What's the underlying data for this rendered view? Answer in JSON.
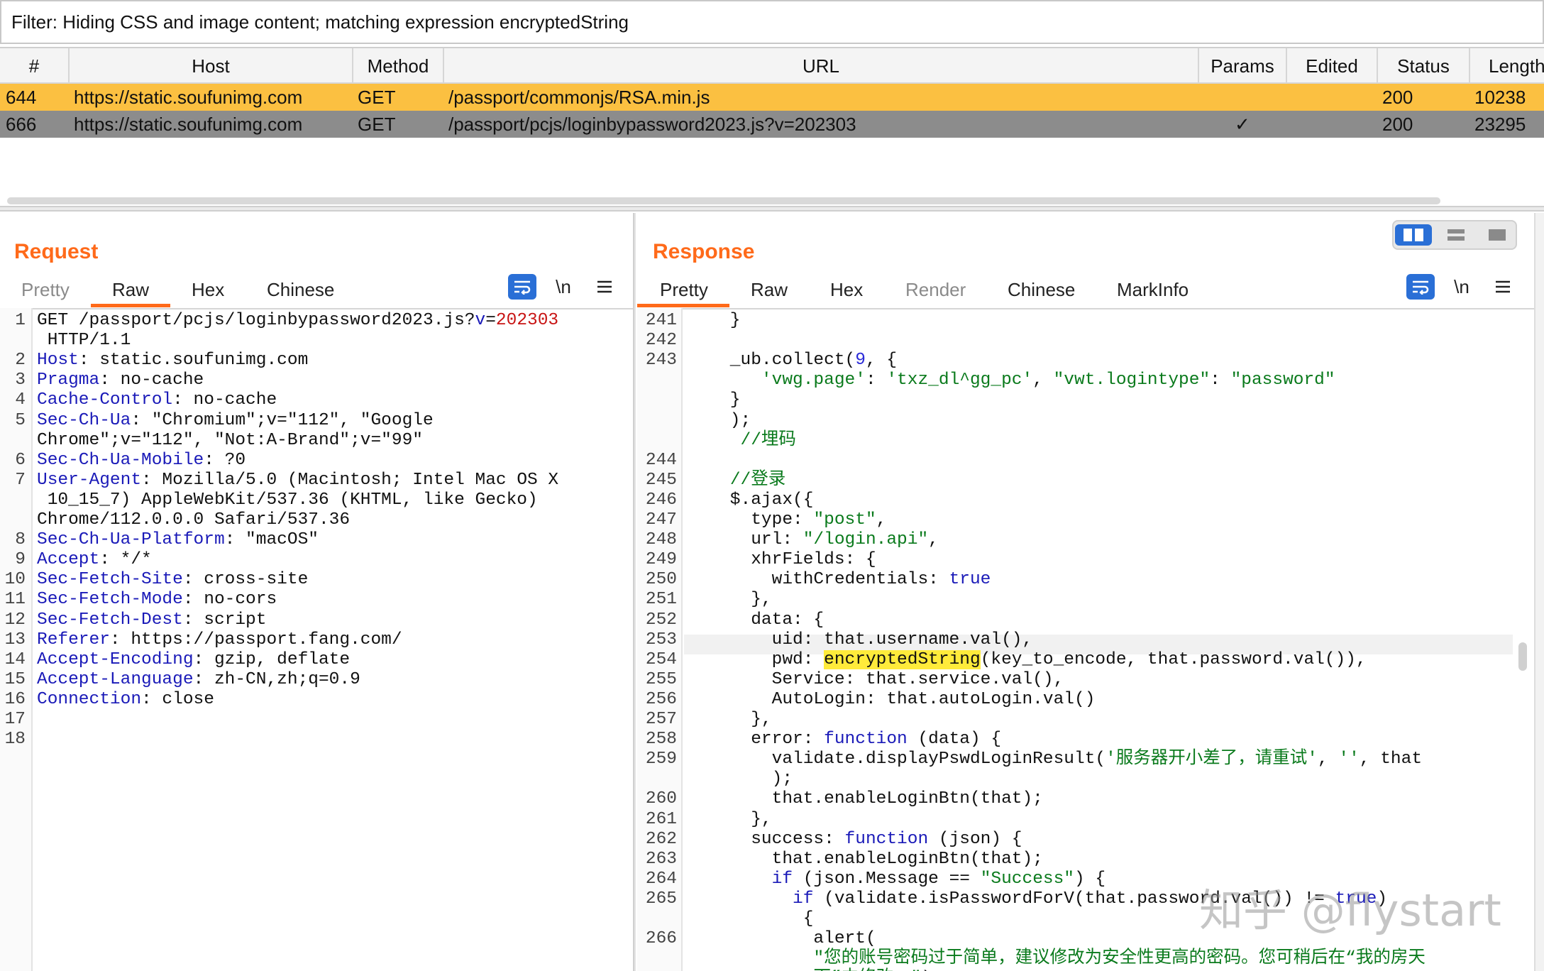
{
  "filter": {
    "text": "Filter: Hiding CSS and image content;  matching expression encryptedString"
  },
  "history": {
    "columns": [
      "#",
      "Host",
      "Method",
      "URL",
      "Params",
      "Edited",
      "Status",
      "Length"
    ],
    "rows": [
      {
        "num": "644",
        "host": "https://static.soufunimg.com",
        "method": "GET",
        "url": "/passport/commonjs/RSA.min.js",
        "params": "",
        "edited": "",
        "status": "200",
        "length": "10238"
      },
      {
        "num": "666",
        "host": "https://static.soufunimg.com",
        "method": "GET",
        "url": "/passport/pcjs/loginbypassword2023.js?v=202303",
        "params": "✓",
        "edited": "",
        "status": "200",
        "length": "23295"
      }
    ]
  },
  "request": {
    "title": "Request",
    "tabs": [
      "Pretty",
      "Raw",
      "Hex",
      "Chinese"
    ],
    "active_tab": "Raw",
    "newline_label": "\\n",
    "lines": [
      {
        "num": "1",
        "parts": [
          [
            "",
            "GET /passport/pcjs/loginbypassword2023.js?"
          ],
          [
            "k",
            "v"
          ],
          [
            "",
            "="
          ],
          [
            "v",
            "202303"
          ]
        ]
      },
      {
        "num": "",
        "parts": [
          [
            "",
            " HTTP/1.1"
          ]
        ]
      },
      {
        "num": "2",
        "parts": [
          [
            "k",
            "Host"
          ],
          [
            "",
            ": static.soufunimg.com"
          ]
        ]
      },
      {
        "num": "3",
        "parts": [
          [
            "k",
            "Pragma"
          ],
          [
            "",
            ": no-cache"
          ]
        ]
      },
      {
        "num": "4",
        "parts": [
          [
            "k",
            "Cache-Control"
          ],
          [
            "",
            ": no-cache"
          ]
        ]
      },
      {
        "num": "5",
        "parts": [
          [
            "k",
            "Sec-Ch-Ua"
          ],
          [
            "",
            ": \"Chromium\";v=\"112\", \"Google"
          ]
        ]
      },
      {
        "num": "",
        "parts": [
          [
            "",
            "Chrome\";v=\"112\", \"Not:A-Brand\";v=\"99\""
          ]
        ]
      },
      {
        "num": "6",
        "parts": [
          [
            "k",
            "Sec-Ch-Ua-Mobile"
          ],
          [
            "",
            ": ?0"
          ]
        ]
      },
      {
        "num": "7",
        "parts": [
          [
            "k",
            "User-Agent"
          ],
          [
            "",
            ": Mozilla/5.0 (Macintosh; Intel Mac OS X"
          ]
        ]
      },
      {
        "num": "",
        "parts": [
          [
            "",
            " 10_15_7) AppleWebKit/537.36 (KHTML, like Gecko)"
          ]
        ]
      },
      {
        "num": "",
        "parts": [
          [
            "",
            "Chrome/112.0.0.0 Safari/537.36"
          ]
        ]
      },
      {
        "num": "8",
        "parts": [
          [
            "k",
            "Sec-Ch-Ua-Platform"
          ],
          [
            "",
            ": \"macOS\""
          ]
        ]
      },
      {
        "num": "9",
        "parts": [
          [
            "k",
            "Accept"
          ],
          [
            "",
            ": */*"
          ]
        ]
      },
      {
        "num": "10",
        "parts": [
          [
            "k",
            "Sec-Fetch-Site"
          ],
          [
            "",
            ": cross-site"
          ]
        ]
      },
      {
        "num": "11",
        "parts": [
          [
            "k",
            "Sec-Fetch-Mode"
          ],
          [
            "",
            ": no-cors"
          ]
        ]
      },
      {
        "num": "12",
        "parts": [
          [
            "k",
            "Sec-Fetch-Dest"
          ],
          [
            "",
            ": script"
          ]
        ]
      },
      {
        "num": "13",
        "parts": [
          [
            "k",
            "Referer"
          ],
          [
            "",
            ": https://passport.fang.com/"
          ]
        ]
      },
      {
        "num": "14",
        "parts": [
          [
            "k",
            "Accept-Encoding"
          ],
          [
            "",
            ": gzip, deflate"
          ]
        ]
      },
      {
        "num": "15",
        "parts": [
          [
            "k",
            "Accept-Language"
          ],
          [
            "",
            ": zh-CN,zh;q=0.9"
          ]
        ]
      },
      {
        "num": "16",
        "parts": [
          [
            "k",
            "Connection"
          ],
          [
            "",
            ": close"
          ]
        ]
      },
      {
        "num": "17",
        "parts": []
      },
      {
        "num": "18",
        "parts": []
      }
    ]
  },
  "response": {
    "title": "Response",
    "tabs": [
      "Pretty",
      "Raw",
      "Hex",
      "Render",
      "Chinese",
      "MarkInfo"
    ],
    "disabled_tabs": [
      "Render"
    ],
    "active_tab": "Pretty",
    "newline_label": "\\n",
    "lines": [
      {
        "num": "241",
        "parts": [
          [
            "",
            "    }"
          ]
        ]
      },
      {
        "num": "242",
        "parts": []
      },
      {
        "num": "243",
        "parts": [
          [
            "",
            "    _ub.collect("
          ],
          [
            "n",
            "9"
          ],
          [
            "",
            ", {"
          ]
        ]
      },
      {
        "num": "",
        "parts": [
          [
            "",
            "       "
          ],
          [
            "s",
            "'vwg.page'"
          ],
          [
            "",
            ": "
          ],
          [
            "s",
            "'txz_dl^gg_pc'"
          ],
          [
            "",
            ", "
          ],
          [
            "s",
            "\"vwt.logintype\""
          ],
          [
            "",
            ": "
          ],
          [
            "s",
            "\"password\""
          ]
        ]
      },
      {
        "num": "",
        "parts": [
          [
            "",
            "    }"
          ]
        ]
      },
      {
        "num": "",
        "parts": [
          [
            "",
            "    );"
          ]
        ]
      },
      {
        "num": "",
        "parts": [
          [
            "",
            "     "
          ],
          [
            "c",
            "//埋码"
          ]
        ]
      },
      {
        "num": "244",
        "parts": []
      },
      {
        "num": "245",
        "parts": [
          [
            "",
            "    "
          ],
          [
            "c",
            "//登录"
          ]
        ]
      },
      {
        "num": "246",
        "parts": [
          [
            "",
            "    $.ajax({"
          ]
        ]
      },
      {
        "num": "247",
        "parts": [
          [
            "",
            "      type: "
          ],
          [
            "s",
            "\"post\""
          ],
          [
            "",
            ","
          ]
        ]
      },
      {
        "num": "248",
        "parts": [
          [
            "",
            "      url: "
          ],
          [
            "s",
            "\"/login.api\""
          ],
          [
            "",
            ","
          ]
        ]
      },
      {
        "num": "249",
        "parts": [
          [
            "",
            "      xhrFields: {"
          ]
        ]
      },
      {
        "num": "250",
        "parts": [
          [
            "",
            "        withCredentials: "
          ],
          [
            "k",
            "true"
          ]
        ]
      },
      {
        "num": "251",
        "parts": [
          [
            "",
            "      },"
          ]
        ]
      },
      {
        "num": "252",
        "parts": [
          [
            "",
            "      data: {"
          ]
        ]
      },
      {
        "num": "253",
        "parts": [
          [
            "",
            "        uid: that.username.val(),"
          ]
        ]
      },
      {
        "num": "254",
        "parts": [
          [
            "",
            "        pwd: "
          ],
          [
            "caret",
            ""
          ],
          [
            "hl",
            "encryptedString"
          ],
          [
            "",
            "(key_to_encode, that.password.val()),"
          ]
        ]
      },
      {
        "num": "255",
        "parts": [
          [
            "",
            "        Service: that.service.val(),"
          ]
        ]
      },
      {
        "num": "256",
        "parts": [
          [
            "",
            "        AutoLogin: that.autoLogin.val()"
          ]
        ]
      },
      {
        "num": "257",
        "parts": [
          [
            "",
            "      },"
          ]
        ]
      },
      {
        "num": "258",
        "parts": [
          [
            "",
            "      error: "
          ],
          [
            "k",
            "function"
          ],
          [
            "",
            " (data) {"
          ]
        ]
      },
      {
        "num": "259",
        "parts": [
          [
            "",
            "        validate.displayPswdLoginResult("
          ],
          [
            "s",
            "'服务器开小差了，请重试'"
          ],
          [
            "",
            ", "
          ],
          [
            "s",
            "''"
          ],
          [
            "",
            ", that"
          ]
        ]
      },
      {
        "num": "",
        "parts": [
          [
            "",
            "        );"
          ]
        ]
      },
      {
        "num": "260",
        "parts": [
          [
            "",
            "        that.enableLoginBtn(that);"
          ]
        ]
      },
      {
        "num": "261",
        "parts": [
          [
            "",
            "      },"
          ]
        ]
      },
      {
        "num": "262",
        "parts": [
          [
            "",
            "      success: "
          ],
          [
            "k",
            "function"
          ],
          [
            "",
            " (json) {"
          ]
        ]
      },
      {
        "num": "263",
        "parts": [
          [
            "",
            "        that.enableLoginBtn(that);"
          ]
        ]
      },
      {
        "num": "264",
        "parts": [
          [
            "",
            "        "
          ],
          [
            "k",
            "if"
          ],
          [
            "",
            " (json.Message == "
          ],
          [
            "s",
            "\"Success\""
          ],
          [
            "",
            ") {"
          ]
        ]
      },
      {
        "num": "265",
        "parts": [
          [
            "",
            "          "
          ],
          [
            "k",
            "if"
          ],
          [
            "",
            " (validate.isPasswordForV(that.password.val()) != "
          ],
          [
            "k",
            "true"
          ],
          [
            "",
            ")"
          ]
        ]
      },
      {
        "num": "",
        "parts": [
          [
            "",
            "           {"
          ]
        ]
      },
      {
        "num": "266",
        "parts": [
          [
            "",
            "            alert("
          ]
        ]
      },
      {
        "num": "",
        "parts": [
          [
            "",
            "            "
          ],
          [
            "s",
            "\"您的账号密码过于简单，建议修改为安全性更高的密码。您可稍后在“我的房天"
          ]
        ]
      },
      {
        "num": "",
        "parts": [
          [
            "",
            "            "
          ],
          [
            "s",
            "下”中修改。\""
          ],
          [
            "",
            ");"
          ]
        ]
      }
    ]
  },
  "watermark": "知乎 @flystart"
}
